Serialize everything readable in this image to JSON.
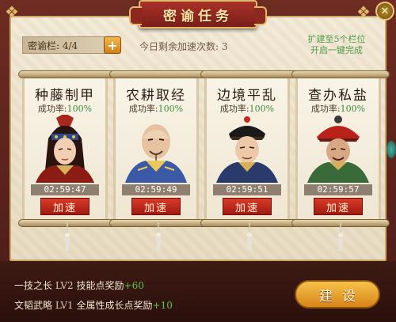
{
  "header": {
    "title": "密谕任务"
  },
  "toolbar": {
    "slot_label": "密谕栏: 4/4",
    "plus_label": "+",
    "speedups_text": "今日剩余加速次数: 3",
    "expand_hint_line1": "扩建至5个栏位",
    "expand_hint_line2": "开启一键完成"
  },
  "cards": [
    {
      "title": "种藤制甲",
      "rate_label": "成功率:",
      "rate_value": "100%",
      "timer": "02:59:47",
      "button": "加速",
      "portrait_icon": "female-warrior-portrait"
    },
    {
      "title": "农耕取经",
      "rate_label": "成功率:",
      "rate_value": "100%",
      "timer": "02:59:49",
      "button": "加速",
      "portrait_icon": "bald-official-portrait"
    },
    {
      "title": "边境平乱",
      "rate_label": "成功率:",
      "rate_value": "100%",
      "timer": "02:59:51",
      "button": "加速",
      "portrait_icon": "official-with-hat-portrait"
    },
    {
      "title": "查办私盐",
      "rate_label": "成功率:",
      "rate_value": "100%",
      "timer": "02:59:57",
      "button": "加速",
      "portrait_icon": "red-hat-official-portrait"
    }
  ],
  "bonuses": [
    {
      "name": "一技之长",
      "level": "LV2",
      "desc": "技能点奖励",
      "value": "+60"
    },
    {
      "name": "文韬武略",
      "level": "LV1",
      "desc": "全属性成长点奖励",
      "value": "+10"
    }
  ],
  "footer": {
    "build_label": "建设"
  },
  "colors": {
    "accent_red": "#a8322a",
    "success_green": "#3f8a3a",
    "gold": "#e0b96a"
  }
}
